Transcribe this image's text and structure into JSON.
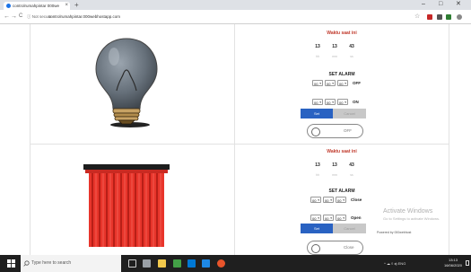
{
  "browser": {
    "tab_title": "controlrumahpintar 000webho",
    "tab_close": "×",
    "new_tab": "+",
    "window_controls": {
      "minimize": "–",
      "maximize": "□",
      "close": "✕"
    },
    "nav": {
      "back": "←",
      "forward": "→",
      "reload": "C"
    },
    "security": "ⓘ Not secure",
    "url": "controlrumahpintar.000webhostapp.com",
    "star": "☆"
  },
  "panels": [
    {
      "device": "lamp",
      "title": "Waktu saat ini",
      "time": {
        "hour": "13",
        "minute": "13",
        "second": "43"
      },
      "time_labels": {
        "hour": "hh",
        "minute": "mm",
        "second": "ss"
      },
      "alarm_header": "SET ALARM",
      "alarm_rows": [
        {
          "hour": "00",
          "minute": "00",
          "second": "00",
          "action": "OFF"
        },
        {
          "hour": "00",
          "minute": "00",
          "second": "00",
          "action": "ON"
        }
      ],
      "set_label": "Set",
      "cancel_label": "Cancel",
      "toggle_label": "OFF"
    },
    {
      "device": "curtain",
      "title": "Waktu saat ini",
      "time": {
        "hour": "13",
        "minute": "13",
        "second": "43"
      },
      "time_labels": {
        "hour": "hh",
        "minute": "mm",
        "second": "ss"
      },
      "alarm_header": "SET ALARM",
      "alarm_rows": [
        {
          "hour": "00",
          "minute": "00",
          "second": "00",
          "action": "Close"
        },
        {
          "hour": "00",
          "minute": "00",
          "second": "00",
          "action": "Open"
        }
      ],
      "set_label": "Set",
      "cancel_label": "Cancel",
      "toggle_label": "Close"
    }
  ],
  "watermark": {
    "title": "Activate Windows",
    "subtitle": "Go to Settings to activate Windows."
  },
  "status_badge": "Powered by 000webhost",
  "taskbar": {
    "search_placeholder": "Type here to search",
    "tray_text": "^ ☁ ◊ ◂) ENG",
    "time": "13:13",
    "date": "16/06/2020"
  },
  "colors": {
    "accent_blue": "#2962c2",
    "title_red": "#c0392b",
    "curtain_red": "#e8352b",
    "taskbar": "#1f1f1f"
  },
  "icons": [
    "chrome-icon",
    "search-icon",
    "windows-icon",
    "lightbulb-icon",
    "curtain-icon"
  ]
}
